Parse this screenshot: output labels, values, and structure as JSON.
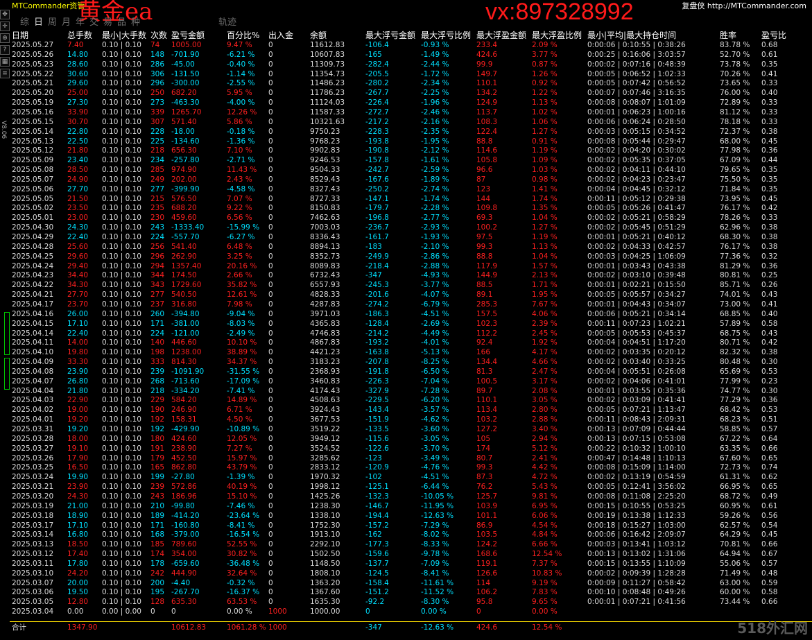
{
  "app_title": "MTCommander资管",
  "brand": {
    "label": "复盘侠",
    "url": "http://MTCommander.com"
  },
  "watermark": {
    "left": "黄金ea",
    "right": "vx:897328992"
  },
  "tabs": [
    "综",
    "日",
    "周",
    "月",
    "年",
    "交",
    "易",
    "品",
    "种",
    "轨迹"
  ],
  "active_tab": "日",
  "toolbar_icons": [
    "move-icon",
    "crosshair-icon",
    "zoom-icon",
    "help-icon",
    "tile-icon",
    "list-icon"
  ],
  "version_label": "V8.06",
  "columns": [
    "日期",
    "总手数",
    "最小|大手数",
    "次数",
    "盈亏金额",
    "百分比%",
    "出入金",
    "余额",
    "最大浮亏金额",
    "最大浮亏比例",
    "最大浮盈金额",
    "最大浮盈比例",
    "最小|平均|最大持仓时间",
    "胜率",
    "盈亏比"
  ],
  "rows": [
    [
      "2025.05.27",
      "7.40",
      "0.10 | 0.10",
      "74",
      "1005.00",
      "9.47 %",
      "0",
      "11612.83",
      "-106.4",
      "-0.93 %",
      "233.4",
      "2.09 %",
      "0:00:06 | 0:10:55 | 0:38:26",
      "83.78 %",
      "0.68"
    ],
    [
      "2025.05.26",
      "14.80",
      "0.10 | 0.10",
      "148",
      "-701.90",
      "-6.21 %",
      "0",
      "10607.83",
      "-165",
      "-1.49 %",
      "424.6",
      "3.77 %",
      "0:00:25 | 0:16:06 | 3:03:57",
      "52.70 %",
      "0.61"
    ],
    [
      "2025.05.23",
      "28.60",
      "0.10 | 0.10",
      "286",
      "-45.00",
      "-0.40 %",
      "0",
      "11309.73",
      "-282.4",
      "-2.44 %",
      "99.9",
      "0.87 %",
      "0:00:02 | 0:07:16 | 0:48:39",
      "73.78 %",
      "0.35"
    ],
    [
      "2025.05.22",
      "30.60",
      "0.10 | 0.10",
      "306",
      "-131.50",
      "-1.14 %",
      "0",
      "11354.73",
      "-205.5",
      "-1.72 %",
      "149.7",
      "1.26 %",
      "0:00:05 | 0:06:52 | 1:02:33",
      "70.26 %",
      "0.41"
    ],
    [
      "2025.05.21",
      "29.60",
      "0.10 | 0.10",
      "296",
      "-300.00",
      "-2.55 %",
      "0",
      "11486.23",
      "-280.2",
      "-2.34 %",
      "110.1",
      "0.92 %",
      "0:00:05 | 0:07:42 | 0:56:52",
      "73.65 %",
      "0.33"
    ],
    [
      "2025.05.20",
      "25.00",
      "0.10 | 0.10",
      "250",
      "682.20",
      "5.95 %",
      "0",
      "11786.23",
      "-267.7",
      "-2.25 %",
      "134.2",
      "1.22 %",
      "0:00:07 | 0:07:46 | 3:16:35",
      "76.00 %",
      "0.40"
    ],
    [
      "2025.05.19",
      "27.30",
      "0.10 | 0.10",
      "273",
      "-463.30",
      "-4.00 %",
      "0",
      "11124.03",
      "-226.4",
      "-1.96 %",
      "124.9",
      "1.13 %",
      "0:00:08 | 0:08:07 | 1:01:09",
      "72.89 %",
      "0.33"
    ],
    [
      "2025.05.16",
      "33.90",
      "0.10 | 0.10",
      "339",
      "1265.70",
      "12.26 %",
      "0",
      "11587.33",
      "-272.7",
      "-2.46 %",
      "113.7",
      "1.02 %",
      "0:00:01 | 0:06:23 | 1:00:16",
      "81.12 %",
      "0.33"
    ],
    [
      "2025.05.15",
      "30.70",
      "0.10 | 0.10",
      "307",
      "571.40",
      "5.86 %",
      "0",
      "10321.63",
      "-217.2",
      "-2.16 %",
      "108.3",
      "1.06 %",
      "0:00:06 | 0:06:24 | 0:28:50",
      "78.18 %",
      "0.33"
    ],
    [
      "2025.05.14",
      "22.80",
      "0.10 | 0.10",
      "228",
      "-18.00",
      "-0.18 %",
      "0",
      "9750.23",
      "-228.3",
      "-2.35 %",
      "122.4",
      "1.27 %",
      "0:00:03 | 0:05:15 | 0:34:52",
      "72.37 %",
      "0.38"
    ],
    [
      "2025.05.13",
      "22.50",
      "0.10 | 0.10",
      "225",
      "-134.60",
      "-1.36 %",
      "0",
      "9768.23",
      "-193.8",
      "-1.95 %",
      "88.8",
      "0.91 %",
      "0:00:08 | 0:05:44 | 0:29:47",
      "68.00 %",
      "0.45"
    ],
    [
      "2025.05.12",
      "21.80",
      "0.10 | 0.10",
      "218",
      "656.30",
      "7.10 %",
      "0",
      "9902.83",
      "-190.8",
      "-2.12 %",
      "114.6",
      "1.19 %",
      "0:00:02 | 0:04:20 | 0:30:02",
      "77.98 %",
      "0.36"
    ],
    [
      "2025.05.09",
      "23.40",
      "0.10 | 0.10",
      "234",
      "-257.80",
      "-2.71 %",
      "0",
      "9246.53",
      "-157.8",
      "-1.61 %",
      "105.8",
      "1.09 %",
      "0:00:02 | 0:05:35 | 0:37:05",
      "67.09 %",
      "0.44"
    ],
    [
      "2025.05.08",
      "28.50",
      "0.10 | 0.10",
      "285",
      "974.90",
      "11.43 %",
      "0",
      "9504.33",
      "-242.7",
      "-2.59 %",
      "96.6",
      "1.03 %",
      "0:00:02 | 0:04:11 | 0:44:10",
      "79.65 %",
      "0.35"
    ],
    [
      "2025.05.07",
      "24.90",
      "0.10 | 0.10",
      "249",
      "202.00",
      "2.43 %",
      "0",
      "8529.43",
      "-167.6",
      "-1.89 %",
      "87",
      "0.98 %",
      "0:00:02 | 0:04:23 | 0:23:47",
      "75.50 %",
      "0.35"
    ],
    [
      "2025.05.06",
      "27.70",
      "0.10 | 0.10",
      "277",
      "-399.90",
      "-4.58 %",
      "0",
      "8327.43",
      "-250.2",
      "-2.74 %",
      "123",
      "1.41 %",
      "0:00:04 | 0:04:45 | 0:32:12",
      "71.84 %",
      "0.35"
    ],
    [
      "2025.05.05",
      "21.50",
      "0.10 | 0.10",
      "215",
      "576.50",
      "7.07 %",
      "0",
      "8727.33",
      "-147.1",
      "-1.74 %",
      "144",
      "1.74 %",
      "0:00:11 | 0:05:12 | 0:29:38",
      "73.95 %",
      "0.45"
    ],
    [
      "2025.05.02",
      "23.50",
      "0.10 | 0.10",
      "235",
      "688.20",
      "9.22 %",
      "0",
      "8150.83",
      "-179.7",
      "-2.28 %",
      "109.8",
      "1.35 %",
      "0:00:05 | 0:05:26 | 0:41:47",
      "76.17 %",
      "0.42"
    ],
    [
      "2025.05.01",
      "23.00",
      "0.10 | 0.10",
      "230",
      "459.60",
      "6.56 %",
      "0",
      "7462.63",
      "-196.8",
      "-2.77 %",
      "69.3",
      "1.04 %",
      "0:00:02 | 0:05:21 | 0:58:29",
      "78.26 %",
      "0.33"
    ],
    [
      "2025.04.30",
      "24.30",
      "0.10 | 0.10",
      "243",
      "-1333.40",
      "-15.99 %",
      "0",
      "7003.03",
      "-236.7",
      "-2.93 %",
      "100.2",
      "1.27 %",
      "0:00:02 | 0:05:45 | 0:51:29",
      "62.96 %",
      "0.38"
    ],
    [
      "2025.04.29",
      "22.40",
      "0.10 | 0.10",
      "224",
      "-557.70",
      "-6.27 %",
      "0",
      "8336.43",
      "-161.7",
      "-1.93 %",
      "97.5",
      "1.19 %",
      "0:00:01 | 0:05:21 | 0:40:12",
      "68.30 %",
      "0.38"
    ],
    [
      "2025.04.28",
      "25.60",
      "0.10 | 0.10",
      "256",
      "541.40",
      "6.48 %",
      "0",
      "8894.13",
      "-183",
      "-2.10 %",
      "99.3",
      "1.13 %",
      "0:00:02 | 0:04:33 | 0:42:57",
      "76.17 %",
      "0.38"
    ],
    [
      "2025.04.25",
      "29.60",
      "0.10 | 0.10",
      "296",
      "262.90",
      "3.25 %",
      "0",
      "8352.73",
      "-249.9",
      "-2.86 %",
      "88.8",
      "1.04 %",
      "0:00:03 | 0:04:25 | 1:06:09",
      "77.36 %",
      "0.32"
    ],
    [
      "2025.04.24",
      "29.40",
      "0.10 | 0.10",
      "294",
      "1357.40",
      "20.16 %",
      "0",
      "8089.83",
      "-218.4",
      "-2.88 %",
      "117.9",
      "1.57 %",
      "0:00:01 | 0:03:43 | 0:43:38",
      "81.29 %",
      "0.36"
    ],
    [
      "2025.04.23",
      "34.40",
      "0.10 | 0.10",
      "344",
      "174.50",
      "2.66 %",
      "0",
      "6732.43",
      "-347",
      "-4.93 %",
      "144.9",
      "2.13 %",
      "0:00:02 | 0:03:10 | 0:39:48",
      "80.81 %",
      "0.25"
    ],
    [
      "2025.04.22",
      "34.30",
      "0.10 | 0.10",
      "343",
      "1729.60",
      "35.82 %",
      "0",
      "6557.93",
      "-245.3",
      "-3.77 %",
      "88.5",
      "1.71 %",
      "0:00:01 | 0:02:21 | 0:15:50",
      "85.71 %",
      "0.26"
    ],
    [
      "2025.04.21",
      "27.70",
      "0.10 | 0.10",
      "277",
      "540.50",
      "12.61 %",
      "0",
      "4828.33",
      "-201.6",
      "-4.07 %",
      "89.1",
      "1.95 %",
      "0:00:05 | 0:05:57 | 0:34:27",
      "74.01 %",
      "0.43"
    ],
    [
      "2025.04.17",
      "23.70",
      "0.10 | 0.10",
      "237",
      "316.80",
      "7.98 %",
      "0",
      "4287.83",
      "-274.2",
      "-6.79 %",
      "285.3",
      "7.67 %",
      "0:00:01 | 0:04:43 | 0:34:07",
      "73.00 %",
      "0.41"
    ],
    [
      "2025.04.16",
      "26.00",
      "0.10 | 0.10",
      "260",
      "-394.80",
      "-9.04 %",
      "0",
      "3971.03",
      "-186.3",
      "-4.51 %",
      "157.5",
      "4.06 %",
      "0:00:06 | 0:05:21 | 0:34:14",
      "68.85 %",
      "0.40"
    ],
    [
      "2025.04.15",
      "17.10",
      "0.10 | 0.10",
      "171",
      "-381.00",
      "-8.03 %",
      "0",
      "4365.83",
      "-128.4",
      "-2.69 %",
      "102.3",
      "2.39 %",
      "0:00:11 | 0:07:23 | 1:02:21",
      "57.89 %",
      "0.58"
    ],
    [
      "2025.04.14",
      "22.40",
      "0.10 | 0.10",
      "224",
      "-121.00",
      "-2.49 %",
      "0",
      "4746.83",
      "-214.2",
      "-4.49 %",
      "112.2",
      "2.45 %",
      "0:00:05 | 0:05:53 | 0:45:37",
      "68.75 %",
      "0.43"
    ],
    [
      "2025.04.11",
      "14.00",
      "0.10 | 0.10",
      "140",
      "446.60",
      "10.10 %",
      "0",
      "4867.83",
      "-193.2",
      "-4.01 %",
      "92.4",
      "1.92 %",
      "0:00:04 | 0:04:51 | 1:17:20",
      "80.71 %",
      "0.42"
    ],
    [
      "2025.04.10",
      "19.80",
      "0.10 | 0.10",
      "198",
      "1238.00",
      "38.89 %",
      "0",
      "4421.23",
      "-163.8",
      "-5.13 %",
      "166",
      "4.17 %",
      "0:00:02 | 0:03:35 | 0:20:12",
      "82.32 %",
      "0.38"
    ],
    [
      "2025.04.09",
      "33.30",
      "0.10 | 0.10",
      "333",
      "814.30",
      "34.37 %",
      "0",
      "3183.23",
      "-207.8",
      "-8.25 %",
      "134.4",
      "4.66 %",
      "0:00:02 | 0:03:40 | 0:33:25",
      "80.48 %",
      "0.30"
    ],
    [
      "2025.04.08",
      "23.90",
      "0.10 | 0.10",
      "239",
      "-1091.90",
      "-31.55 %",
      "0",
      "2368.93",
      "-191.8",
      "-6.50 %",
      "81.3",
      "2.47 %",
      "0:00:04 | 0:05:51 | 0:26:08",
      "65.69 %",
      "0.53"
    ],
    [
      "2025.04.07",
      "26.80",
      "0.10 | 0.10",
      "268",
      "-713.60",
      "-17.09 %",
      "0",
      "3460.83",
      "-226.3",
      "-7.04 %",
      "100.5",
      "3.17 %",
      "0:00:02 | 0:04:06 | 0:41:01",
      "77.99 %",
      "0.23"
    ],
    [
      "2025.04.04",
      "21.80",
      "0.10 | 0.10",
      "218",
      "-334.20",
      "-7.41 %",
      "0",
      "4174.43",
      "-327.9",
      "-7.28 %",
      "89.7",
      "2.08 %",
      "0:00:01 | 0:03:55 | 0:35:36",
      "74.77 %",
      "0.30"
    ],
    [
      "2025.04.03",
      "22.90",
      "0.10 | 0.10",
      "229",
      "584.20",
      "14.89 %",
      "0",
      "4508.63",
      "-229.5",
      "-6.20 %",
      "110.1",
      "3.05 %",
      "0:00:02 | 0:03:09 | 0:41:41",
      "77.29 %",
      "0.36"
    ],
    [
      "2025.04.02",
      "19.00",
      "0.10 | 0.10",
      "190",
      "246.90",
      "6.71 %",
      "0",
      "3924.43",
      "-143.4",
      "-3.57 %",
      "113.4",
      "2.80 %",
      "0:00:05 | 0:07:21 | 1:13:47",
      "68.42 %",
      "0.53"
    ],
    [
      "2025.04.01",
      "19.20",
      "0.10 | 0.10",
      "192",
      "158.31",
      "4.50 %",
      "0",
      "3677.53",
      "-151.9",
      "-4.62 %",
      "103.2",
      "2.88 %",
      "0:00:11 | 0:08:43 | 2:09:31",
      "68.23 %",
      "0.51"
    ],
    [
      "2025.03.31",
      "19.20",
      "0.10 | 0.10",
      "192",
      "-429.90",
      "-10.89 %",
      "0",
      "3519.22",
      "-133.5",
      "-3.60 %",
      "127.2",
      "3.40 %",
      "0:00:13 | 0:07:09 | 0:44:44",
      "58.85 %",
      "0.57"
    ],
    [
      "2025.03.28",
      "18.00",
      "0.10 | 0.10",
      "180",
      "424.60",
      "12.05 %",
      "0",
      "3949.12",
      "-115.6",
      "-3.05 %",
      "105",
      "2.94 %",
      "0:00:13 | 0:07:15 | 0:53:08",
      "67.22 %",
      "0.64"
    ],
    [
      "2025.03.27",
      "19.10",
      "0.10 | 0.10",
      "191",
      "238.90",
      "7.27 %",
      "0",
      "3524.52",
      "-122.6",
      "-3.70 %",
      "174",
      "5.12 %",
      "0:00:22 | 0:10:32 | 1:00:10",
      "63.35 %",
      "0.66"
    ],
    [
      "2025.03.26",
      "17.90",
      "0.10 | 0.10",
      "179",
      "452.50",
      "15.97 %",
      "0",
      "3285.62",
      "-123",
      "-3.49 %",
      "80.7",
      "2.41 %",
      "0:00:47 | 0:14:48 | 1:10:13",
      "67.60 %",
      "0.65"
    ],
    [
      "2025.03.25",
      "16.50",
      "0.10 | 0.10",
      "165",
      "862.80",
      "43.79 %",
      "0",
      "2833.12",
      "-120.9",
      "-4.76 %",
      "99.3",
      "4.42 %",
      "0:00:08 | 0:15:09 | 1:14:00",
      "72.73 %",
      "0.74"
    ],
    [
      "2025.03.24",
      "19.90",
      "0.10 | 0.10",
      "199",
      "-27.80",
      "-1.39 %",
      "0",
      "1970.32",
      "-102",
      "-4.51 %",
      "87.3",
      "4.72 %",
      "0:00:02 | 0:13:19 | 0:54:59",
      "61.31 %",
      "0.62"
    ],
    [
      "2025.03.21",
      "23.90",
      "0.10 | 0.10",
      "239",
      "572.86",
      "40.19 %",
      "0",
      "1998.12",
      "-125.1",
      "-6.44 %",
      "76.2",
      "5.43 %",
      "0:00:05 | 0:12:41 | 3:56:02",
      "66.95 %",
      "0.65"
    ],
    [
      "2025.03.20",
      "24.30",
      "0.10 | 0.10",
      "243",
      "186.96",
      "15.10 %",
      "0",
      "1425.26",
      "-132.3",
      "-10.05 %",
      "125.7",
      "9.81 %",
      "0:00:08 | 0:11:08 | 2:25:20",
      "68.72 %",
      "0.49"
    ],
    [
      "2025.03.19",
      "21.00",
      "0.10 | 0.10",
      "210",
      "-99.80",
      "-7.46 %",
      "0",
      "1238.30",
      "-146.7",
      "-11.95 %",
      "103.9",
      "6.95 %",
      "0:00:15 | 0:10:55 | 0:53:25",
      "60.95 %",
      "0.61"
    ],
    [
      "2025.03.18",
      "18.90",
      "0.10 | 0.10",
      "189",
      "-414.20",
      "-23.64 %",
      "0",
      "1338.10",
      "-194.4",
      "-12.63 %",
      "101.1",
      "6.06 %",
      "0:00:19 | 0:13:38 | 1:12:33",
      "59.26 %",
      "0.56"
    ],
    [
      "2025.03.17",
      "17.10",
      "0.10 | 0.10",
      "171",
      "-160.80",
      "-8.41 %",
      "0",
      "1752.30",
      "-157.2",
      "-7.29 %",
      "86.9",
      "4.54 %",
      "0:00:18 | 0:15:27 | 1:03:00",
      "62.57 %",
      "0.54"
    ],
    [
      "2025.03.14",
      "16.80",
      "0.10 | 0.10",
      "168",
      "-379.00",
      "-16.54 %",
      "0",
      "1913.10",
      "-162",
      "-8.02 %",
      "103.5",
      "4.84 %",
      "0:00:06 | 0:16:42 | 2:09:07",
      "64.29 %",
      "0.45"
    ],
    [
      "2025.03.13",
      "18.50",
      "0.10 | 0.10",
      "185",
      "789.60",
      "52.55 %",
      "0",
      "2292.10",
      "-177.3",
      "-8.33 %",
      "124.2",
      "6.66 %",
      "0:00:03 | 0:13:41 | 1:03:12",
      "70.81 %",
      "0.66"
    ],
    [
      "2025.03.12",
      "17.40",
      "0.10 | 0.10",
      "174",
      "354.00",
      "30.82 %",
      "0",
      "1502.50",
      "-159.6",
      "-9.78 %",
      "168.6",
      "12.54 %",
      "0:00:13 | 0:13:02 | 1:31:06",
      "64.94 %",
      "0.67"
    ],
    [
      "2025.03.11",
      "17.80",
      "0.10 | 0.10",
      "178",
      "-659.60",
      "-36.48 %",
      "0",
      "1148.50",
      "-137.7",
      "-7.09 %",
      "119.1",
      "7.37 %",
      "0:00:15 | 0:13:55 | 1:10:09",
      "55.06 %",
      "0.57"
    ],
    [
      "2025.03.10",
      "24.20",
      "0.10 | 0.10",
      "242",
      "444.90",
      "32.64 %",
      "0",
      "1808.10",
      "-124.5",
      "-8.41 %",
      "126.6",
      "10.83 %",
      "0:00:02 | 0:09:39 | 1:28:28",
      "71.49 %",
      "0.48"
    ],
    [
      "2025.03.07",
      "20.00",
      "0.10 | 0.10",
      "200",
      "-4.40",
      "-0.32 %",
      "0",
      "1363.20",
      "-158.4",
      "-11.61 %",
      "114",
      "9.19 %",
      "0:00:09 | 0:11:27 | 0:58:42",
      "63.00 %",
      "0.59"
    ],
    [
      "2025.03.06",
      "19.50",
      "0.10 | 0.10",
      "195",
      "-267.70",
      "-16.37 %",
      "0",
      "1367.60",
      "-151.2",
      "-11.52 %",
      "106.2",
      "7.83 %",
      "0:00:10 | 0:08:48 | 0:49:26",
      "60.00 %",
      "0.58"
    ],
    [
      "2025.03.05",
      "12.80",
      "0.10 | 0.10",
      "128",
      "635.30",
      "63.53 %",
      "0",
      "1635.30",
      "-92.2",
      "-8.30 %",
      "95.8",
      "9.65 %",
      "0:00:01 | 0:07:21 | 0:41:56",
      "73.44 %",
      "0.66"
    ],
    [
      "2025.03.04",
      "0.00",
      "0.00 | 0.00",
      "0",
      "0",
      "0.00 %",
      "1000",
      "1000.00",
      "0",
      "0.00 %",
      "0",
      "0.00 %",
      "",
      "",
      ""
    ]
  ],
  "totals": [
    "合计",
    "1347.90",
    "",
    "",
    "10612.83",
    "1061.28 %",
    "1000",
    "",
    "-347",
    "-12.63 %",
    "424.6",
    "12.54 %",
    "",
    "",
    ""
  ],
  "logo": "518外汇网",
  "colors": {
    "positive": "#ff2020",
    "negative": "#00e0ff",
    "neutral": "#dcdcdc",
    "separator": "#ffe000"
  }
}
